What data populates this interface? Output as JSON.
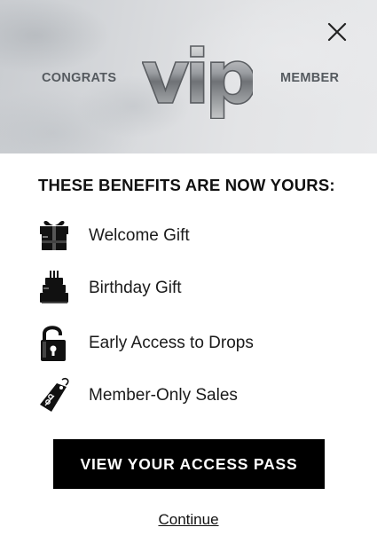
{
  "header": {
    "left_label": "CONGRATS",
    "logo_text": "vip",
    "right_label": "MEMBER",
    "close_icon": "close-icon"
  },
  "benefits": {
    "title": "THESE BENEFITS ARE NOW YOURS:",
    "items": [
      {
        "icon": "gift-icon",
        "label": "Welcome Gift"
      },
      {
        "icon": "cake-icon",
        "label": "Birthday Gift"
      },
      {
        "icon": "unlocked-padlock-icon",
        "label": "Early Access to Drops"
      },
      {
        "icon": "sale-tag-icon",
        "label": "Member-Only Sales"
      }
    ]
  },
  "actions": {
    "primary_label": "VIEW YOUR ACCESS PASS",
    "secondary_label": "Continue"
  },
  "colors": {
    "button_background": "#000000",
    "button_text": "#ffffff",
    "header_label": "#555a5f"
  }
}
